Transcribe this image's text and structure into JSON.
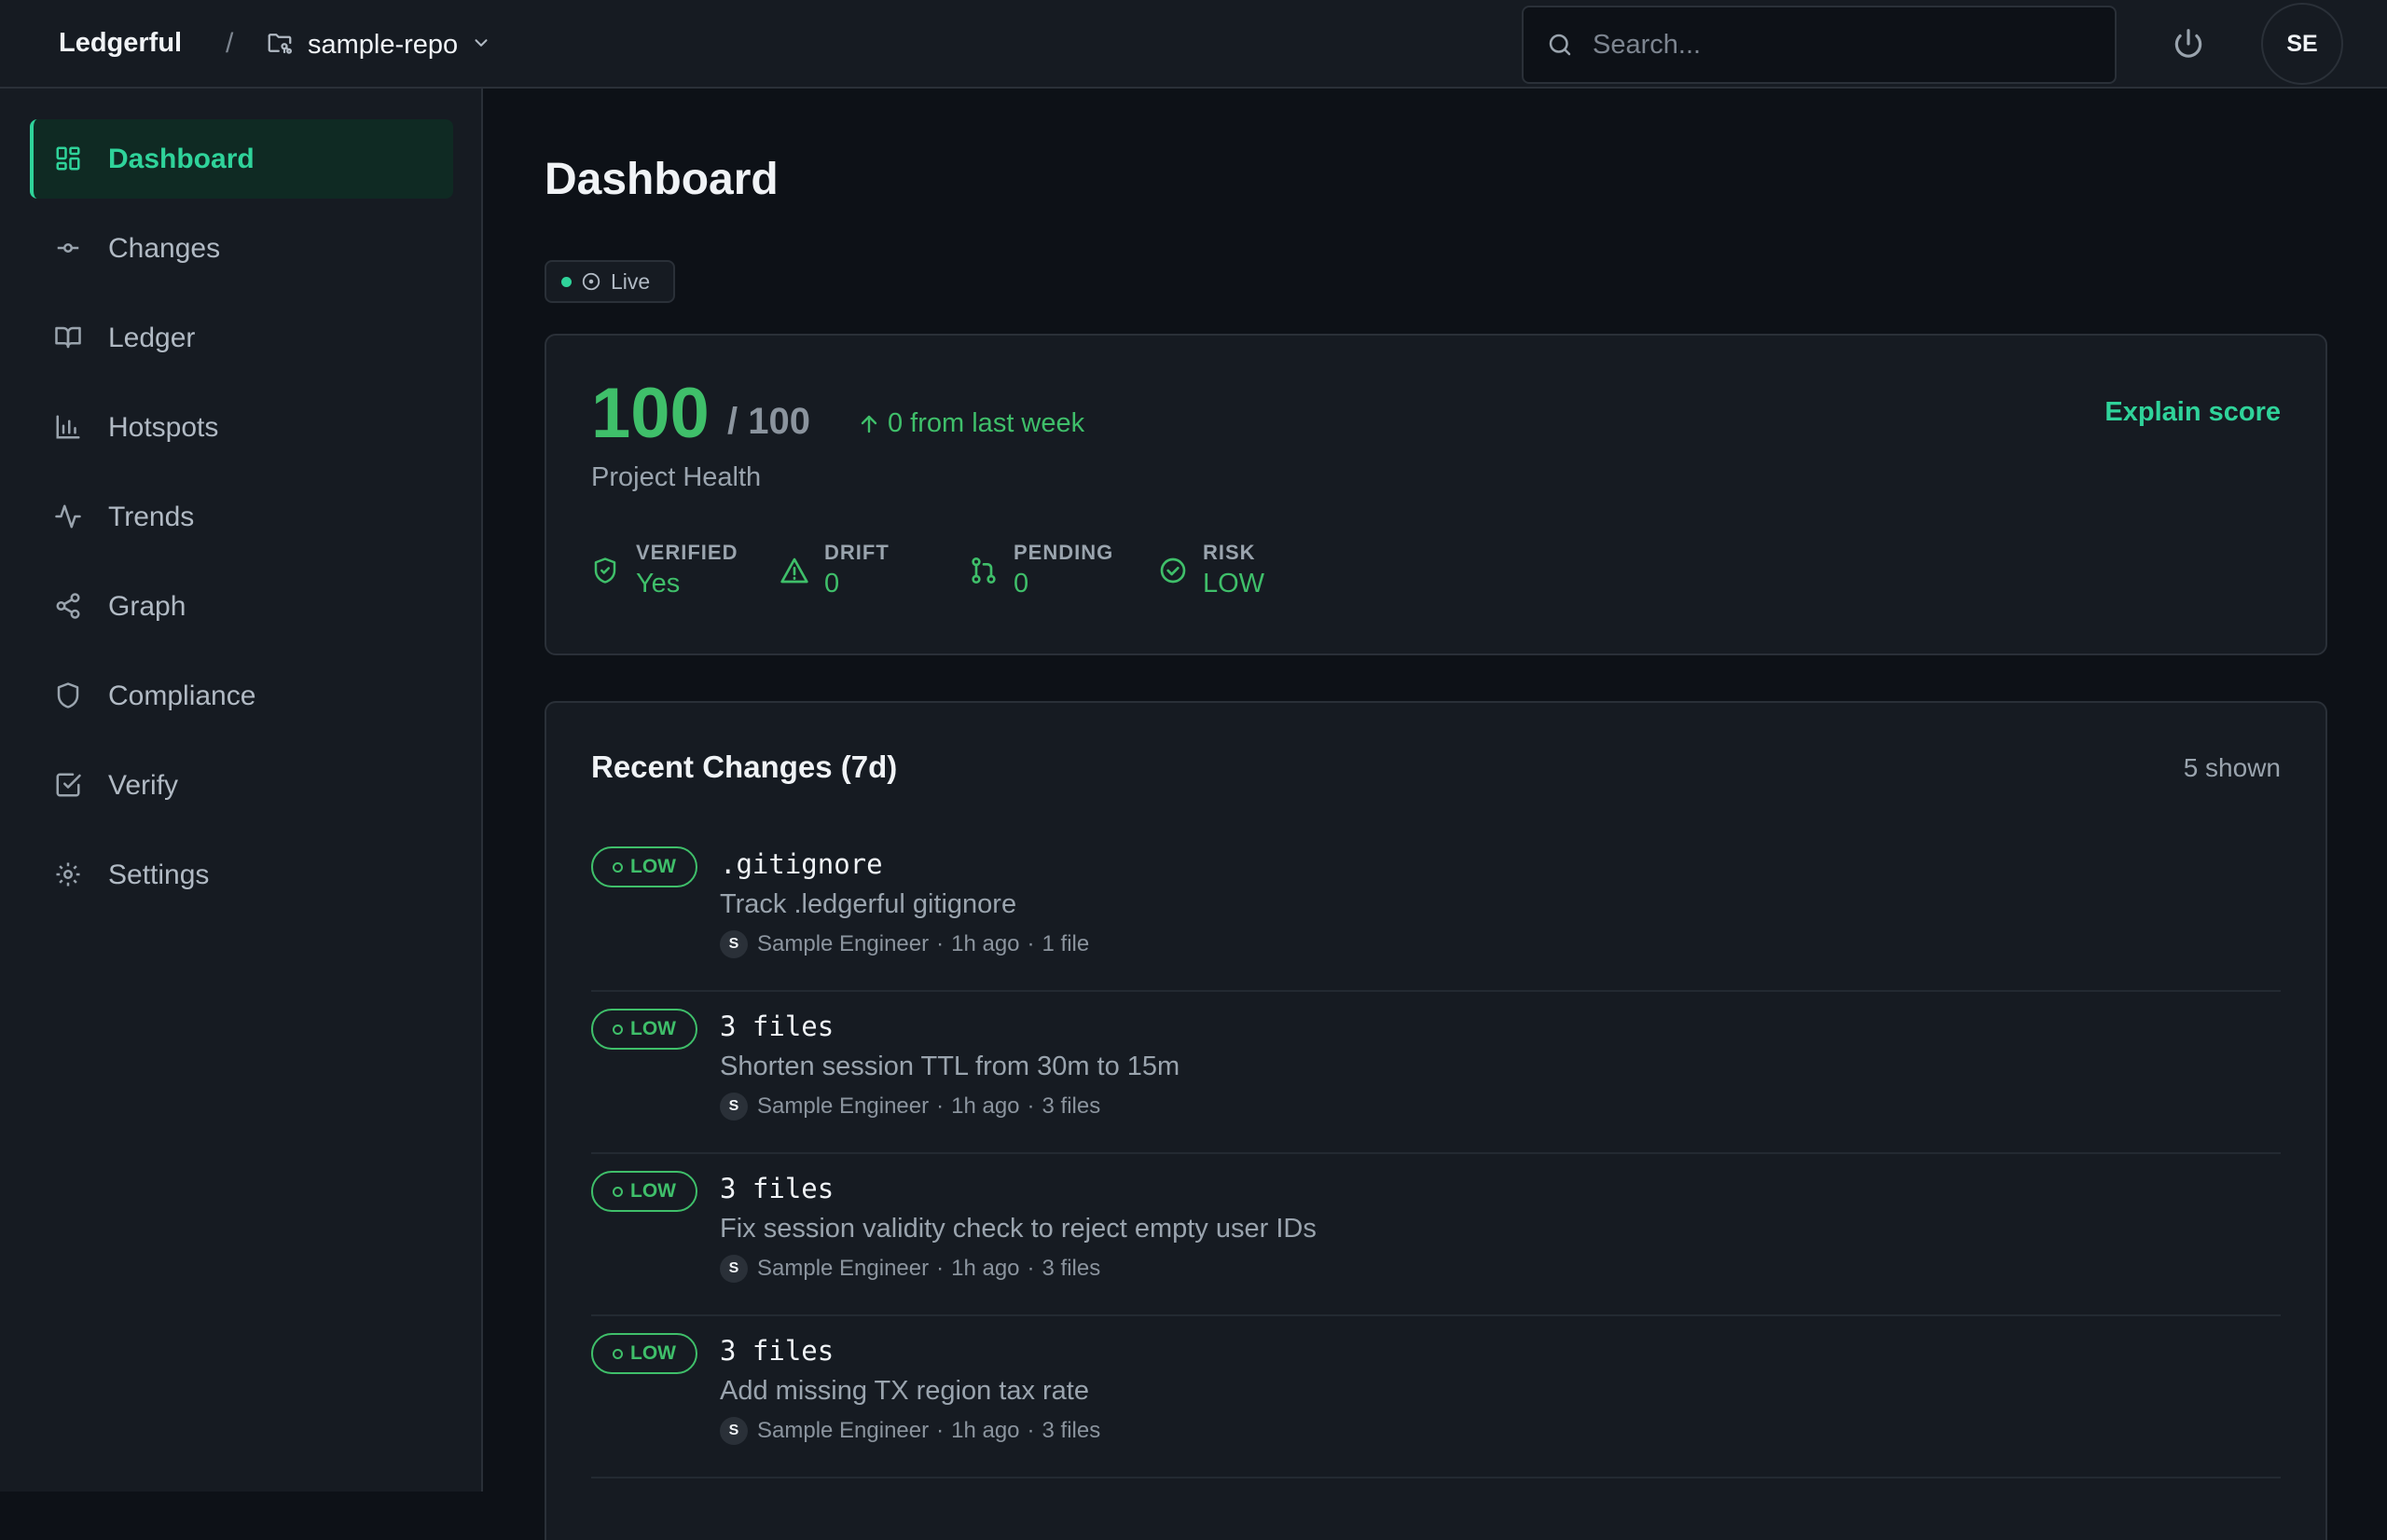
{
  "header": {
    "brand": "Ledgerful",
    "separator": "/",
    "repo_name": "sample-repo",
    "search_placeholder": "Search...",
    "avatar_initials": "SE"
  },
  "sidebar": {
    "items": [
      {
        "label": "Dashboard",
        "icon": "dashboard-icon",
        "active": true
      },
      {
        "label": "Changes",
        "icon": "commit-icon"
      },
      {
        "label": "Ledger",
        "icon": "book-icon"
      },
      {
        "label": "Hotspots",
        "icon": "bar-chart-icon"
      },
      {
        "label": "Trends",
        "icon": "activity-icon"
      },
      {
        "label": "Graph",
        "icon": "share-nodes-icon"
      },
      {
        "label": "Compliance",
        "icon": "shield-icon"
      },
      {
        "label": "Verify",
        "icon": "check-square-icon"
      },
      {
        "label": "Settings",
        "icon": "gear-icon"
      }
    ]
  },
  "main": {
    "title": "Dashboard",
    "live_label": "Live",
    "health": {
      "score": "100",
      "max": "/ 100",
      "delta": "0 from last week",
      "label": "Project Health",
      "explain": "Explain score",
      "stats": [
        {
          "key": "VERIFIED",
          "value": "Yes",
          "icon": "shield-check-icon"
        },
        {
          "key": "DRIFT",
          "value": "0",
          "icon": "warning-icon"
        },
        {
          "key": "PENDING",
          "value": "0",
          "icon": "git-pull-request-icon"
        },
        {
          "key": "RISK",
          "value": "LOW",
          "icon": "check-circle-icon"
        }
      ]
    },
    "changes": {
      "title": "Recent Changes (7d)",
      "count": "5 shown",
      "rows": [
        {
          "risk": "LOW",
          "title": ".gitignore",
          "message": "Track .ledgerful gitignore",
          "author_initial": "S",
          "author": "Sample Engineer",
          "time": "1h ago",
          "files": "1 file"
        },
        {
          "risk": "LOW",
          "title": "3 files",
          "message": "Shorten session TTL from 30m to 15m",
          "author_initial": "S",
          "author": "Sample Engineer",
          "time": "1h ago",
          "files": "3 files"
        },
        {
          "risk": "LOW",
          "title": "3 files",
          "message": "Fix session validity check to reject empty user IDs",
          "author_initial": "S",
          "author": "Sample Engineer",
          "time": "1h ago",
          "files": "3 files"
        },
        {
          "risk": "LOW",
          "title": "3 files",
          "message": "Add missing TX region tax rate",
          "author_initial": "S",
          "author": "Sample Engineer",
          "time": "1h ago",
          "files": "3 files"
        }
      ]
    }
  },
  "colors": {
    "accent": "#2fd39a",
    "success": "#3fbf6a",
    "background": "#0d1117",
    "panel": "#161b22"
  }
}
